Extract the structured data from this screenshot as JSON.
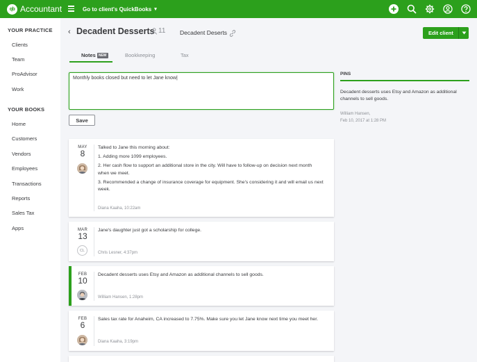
{
  "topbar": {
    "logo_mark": "qb",
    "app_name": "Accountant",
    "client_switch_label": "Go to client's QuickBooks",
    "icons": [
      "plus-icon",
      "search-icon",
      "gear-icon",
      "user-icon",
      "help-icon"
    ]
  },
  "sidebar": {
    "section1": "YOUR PRACTICE",
    "practice_items": [
      "Clients",
      "Team",
      "ProAdvisor",
      "Work"
    ],
    "section2": "YOUR BOOKS",
    "books_items": [
      "Home",
      "Customers",
      "Vendors",
      "Employees",
      "Transactions",
      "Reports",
      "Sales Tax",
      "Apps"
    ]
  },
  "header": {
    "title": "Decadent Desserts",
    "member_count": "11",
    "subtitle": "Decadent Deserts",
    "edit_button": "Edit client"
  },
  "tabs": [
    {
      "label": "Notes",
      "badge": "NEW",
      "active": true
    },
    {
      "label": "Bookkeeping",
      "active": false
    },
    {
      "label": "Tax",
      "active": false
    }
  ],
  "note_input": {
    "value": "Monthly books closed but need to let Jane know|"
  },
  "save_button": "Save",
  "pins": {
    "title": "PINS",
    "text": "Decadent desserts uses Etsy and Amazon as additional channels to sell goods.",
    "author": "William Hansen,",
    "date": "Feb 10, 2017 at 1:28 PM"
  },
  "notes": [
    {
      "month": "MAY",
      "day": "8",
      "lines": [
        "Talked to Jane this morning about:",
        "1. Adding more 1099 employees.",
        "2. Her cash flow to support an additional store in the city. Will have to follow-up on decision next month when we meet.",
        "3. Recommended a change of insurance coverage for equipment. She's considering it and will email us next week."
      ],
      "meta": "Diana Kaaha, 10:22am",
      "avatar": "photo"
    },
    {
      "month": "MAR",
      "day": "13",
      "lines": [
        "Jane's daughter just got a scholarship for college."
      ],
      "meta": "Chris Lesner, 4:37pm",
      "avatar_initials": "CL"
    },
    {
      "month": "FEB",
      "day": "10",
      "lines": [
        "Decadent desserts uses Etsy and Amazon as additional channels to sell goods."
      ],
      "meta": "William Hansen, 1:28pm",
      "avatar": "photo"
    },
    {
      "month": "FEB",
      "day": "6",
      "lines": [
        "Sales tax rate for Anaheim, CA increased to 7.75%. Make sure you let Jane know next time you meet her."
      ],
      "meta": "Diana Kaaha, 3:19pm",
      "avatar": "photo"
    }
  ],
  "colors": {
    "brand_green": "#2ca01c",
    "text": "#393a3d",
    "muted": "#8d9096"
  }
}
